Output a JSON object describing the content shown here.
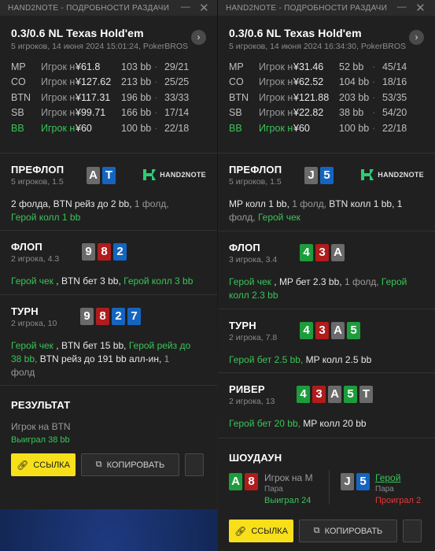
{
  "panels": [
    {
      "window_title": "HAND2NOTE - ПОДРОБНОСТИ РАЗДАЧИ",
      "game": "0.3/0.6 NL Texas Hold'em",
      "subtitle": "5 игроков, 14 июня 2024 15:01:24, PokerBROS",
      "players": [
        {
          "pos": "MP",
          "name": "Игрок н",
          "amount": "¥61.8",
          "bb": "103 bb",
          "stat": "29/21"
        },
        {
          "pos": "CO",
          "name": "Игрок н",
          "amount": "¥127.62",
          "bb": "213 bb",
          "stat": "25/25"
        },
        {
          "pos": "BTN",
          "name": "Игрок н",
          "amount": "¥117.31",
          "bb": "196 bb",
          "stat": "33/33"
        },
        {
          "pos": "SB",
          "name": "Игрок н",
          "amount": "¥99.71",
          "bb": "166 bb",
          "stat": "17/14"
        },
        {
          "pos": "BB",
          "name": "Игрок н",
          "amount": "¥60",
          "bb": "100 bb",
          "stat": "22/18"
        }
      ],
      "preflop": {
        "title": "ПРЕФЛОП",
        "sub": "5 игроков, 1.5",
        "cards": [
          "A",
          "T"
        ],
        "logo": "HAND2NOTE",
        "a1": "2 фолда, BTN рейз до 2 bb,",
        "a2": " 1 фолд,",
        "a3": "Герой колл 1 bb"
      },
      "flop": {
        "title": "ФЛОП",
        "sub": "2 игрока, 4.3",
        "cards": [
          "9",
          "8",
          "2"
        ],
        "a1": "Герой чек",
        "a2": " , BTN бет 3 bb,",
        "a3": " Герой колл 3 bb"
      },
      "turn": {
        "title": "ТУРН",
        "sub": "2 игрока, 10",
        "cards": [
          "9",
          "8",
          "2",
          "7"
        ],
        "a1": "Герой чек",
        "a2": " , BTN бет 15 bb,",
        "a3": " Герой рейз до",
        "a4": "38 bb,",
        "a5": " BTN рейз до 191 bb алл-ин,",
        "a6": " 1",
        "a7": "фолд"
      },
      "result": {
        "title": "РЕЗУЛЬТАТ",
        "player": "Игрок на BTN",
        "won": "Выиграл 38 bb"
      },
      "link_label": "ССЫЛКА",
      "copy_label": "КОПИРОВАТЬ"
    },
    {
      "window_title": "HAND2NOTE - ПОДРОБНОСТИ РАЗДАЧИ",
      "game": "0.3/0.6 NL Texas Hold'em",
      "subtitle": "5 игроков, 14 июня 2024 16:34:30, PokerBROS",
      "players": [
        {
          "pos": "MP",
          "name": "Игрок н",
          "amount": "¥31.46",
          "bb": "52 bb",
          "stat": "45/14"
        },
        {
          "pos": "CO",
          "name": "Игрок н",
          "amount": "¥62.52",
          "bb": "104 bb",
          "stat": "18/16"
        },
        {
          "pos": "BTN",
          "name": "Игрок н",
          "amount": "¥121.88",
          "bb": "203 bb",
          "stat": "53/35"
        },
        {
          "pos": "SB",
          "name": "Игрок н",
          "amount": "¥22.82",
          "bb": "38 bb",
          "stat": "54/20"
        },
        {
          "pos": "BB",
          "name": "Игрок н",
          "amount": "¥60",
          "bb": "100 bb",
          "stat": "22/18"
        }
      ],
      "preflop": {
        "title": "ПРЕФЛОП",
        "sub": "5 игроков, 1.5",
        "cards": [
          "J",
          "5"
        ],
        "logo": "HAND2NOTE",
        "a1": "MP колл 1 bb,",
        "a2": " 1 фолд,",
        "a3": " BTN колл 1 bb, 1",
        "a4": "фолд,",
        "a5": " Герой чек"
      },
      "flop": {
        "title": "ФЛОП",
        "sub": "3 игрока, 3.4",
        "cards": [
          "4",
          "3",
          "A"
        ],
        "a1": "Герой чек",
        "a2": " , MP бет 2.3 bb,",
        "a3": " 1 фолд,",
        "a4": " Герой",
        "a5": "колл 2.3 bb"
      },
      "turn": {
        "title": "ТУРН",
        "sub": "2 игрока, 7.8",
        "cards": [
          "4",
          "3",
          "A",
          "5"
        ],
        "a1": "Герой бет 2.5 bb,",
        "a2": " MP колл 2.5 bb"
      },
      "river": {
        "title": "РИВЕР",
        "sub": "2 игрока, 13",
        "cards": [
          "4",
          "3",
          "A",
          "5",
          "T"
        ],
        "a1": "Герой бет 20 bb,",
        "a2": " MP колл 20 bb"
      },
      "showdown": {
        "title": "ШОУДАУН",
        "l_cards": [
          "A",
          "8"
        ],
        "l_name": "Игрок на M",
        "l_hand": "Пара",
        "l_res": "Выиграл 24",
        "r_cards": [
          "J",
          "5"
        ],
        "r_name": "Герой",
        "r_hand": "Пара",
        "r_res": "Проиграл 2"
      },
      "link_label": "ССЫЛКА",
      "copy_label": "КОПИРОВАТЬ"
    }
  ],
  "colors": {
    "hero": "#38c558",
    "accent": "#f7e01a",
    "lose": "#e53935"
  }
}
